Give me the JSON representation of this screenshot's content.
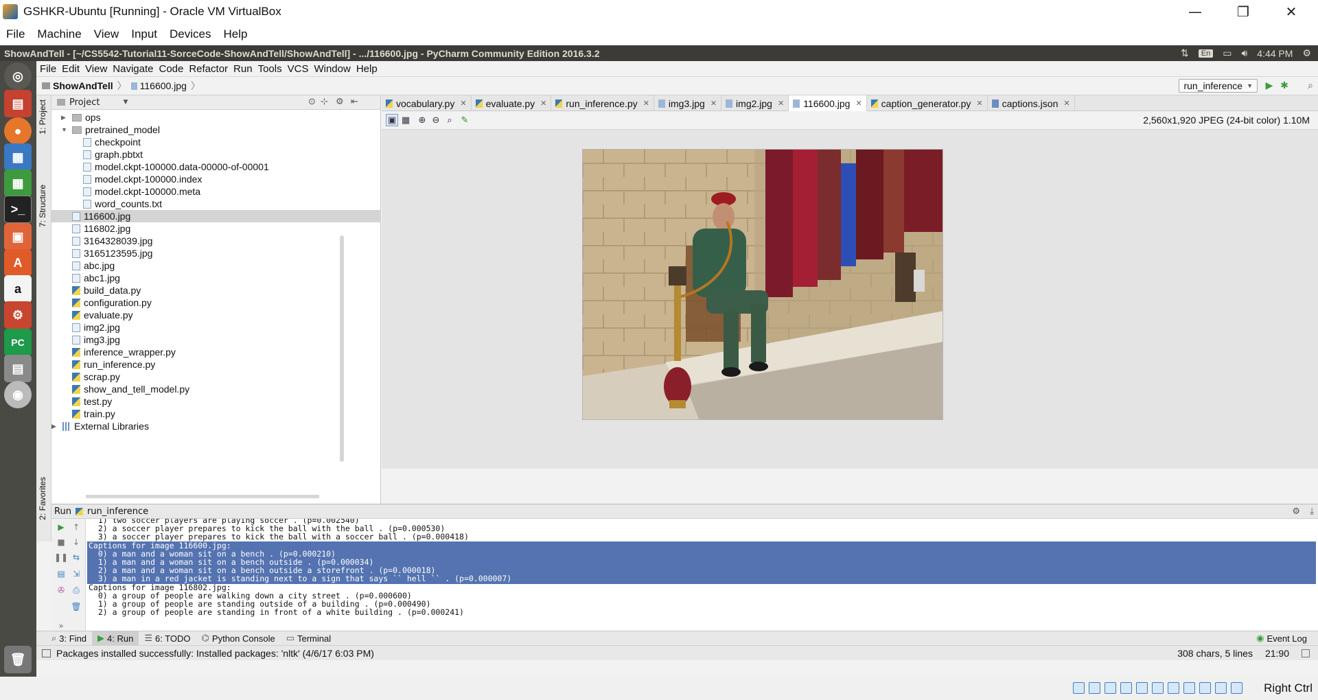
{
  "vbox": {
    "window_title": "GSHKR-Ubuntu [Running] - Oracle VM VirtualBox",
    "menu": [
      "File",
      "Machine",
      "View",
      "Input",
      "Devices",
      "Help"
    ],
    "host_key": "Right Ctrl"
  },
  "ubuntu": {
    "topbar_title": "ShowAndTell - [~/CS5542-Tutorial11-SorceCode-ShowAndTell/ShowAndTell] - .../116600.jpg - PyCharm Community Edition 2016.3.2",
    "keyboard": "En",
    "clock": "4:44 PM",
    "launcher_letters": {
      "pycharm": "PC",
      "software": "A",
      "amazon": "a"
    }
  },
  "pycharm": {
    "menu": [
      "File",
      "Edit",
      "View",
      "Navigate",
      "Code",
      "Refactor",
      "Run",
      "Tools",
      "VCS",
      "Window",
      "Help"
    ],
    "breadcrumb": [
      "ShowAndTell",
      "116600.jpg"
    ],
    "run_config": "run_inference",
    "side_tabs": {
      "project": "1: Project",
      "structure": "7: Structure",
      "favorites": "2: Favorites"
    },
    "project_panel": {
      "title": "Project",
      "tree": [
        {
          "label": "ops",
          "type": "folder",
          "arrow": "▶"
        },
        {
          "label": "pretrained_model",
          "type": "folder",
          "arrow": "▼"
        },
        {
          "label": "checkpoint",
          "type": "file"
        },
        {
          "label": "graph.pbtxt",
          "type": "file"
        },
        {
          "label": "model.ckpt-100000.data-00000-of-00001",
          "type": "file"
        },
        {
          "label": "model.ckpt-100000.index",
          "type": "file"
        },
        {
          "label": "model.ckpt-100000.meta",
          "type": "file"
        },
        {
          "label": "word_counts.txt",
          "type": "file"
        },
        {
          "label": "116600.jpg",
          "type": "img",
          "selected": true
        },
        {
          "label": "116802.jpg",
          "type": "img"
        },
        {
          "label": "3164328039.jpg",
          "type": "img"
        },
        {
          "label": "3165123595.jpg",
          "type": "img"
        },
        {
          "label": "abc.jpg",
          "type": "img"
        },
        {
          "label": "abc1.jpg",
          "type": "img"
        },
        {
          "label": "build_data.py",
          "type": "py"
        },
        {
          "label": "configuration.py",
          "type": "py"
        },
        {
          "label": "evaluate.py",
          "type": "py"
        },
        {
          "label": "img2.jpg",
          "type": "img"
        },
        {
          "label": "img3.jpg",
          "type": "img"
        },
        {
          "label": "inference_wrapper.py",
          "type": "py"
        },
        {
          "label": "run_inference.py",
          "type": "py"
        },
        {
          "label": "scrap.py",
          "type": "py"
        },
        {
          "label": "show_and_tell_model.py",
          "type": "py"
        },
        {
          "label": "test.py",
          "type": "py"
        },
        {
          "label": "train.py",
          "type": "py"
        },
        {
          "label": "External Libraries",
          "type": "lib",
          "arrow": "▶"
        }
      ]
    },
    "tabs": [
      {
        "label": "vocabulary.py",
        "type": "py"
      },
      {
        "label": "evaluate.py",
        "type": "py"
      },
      {
        "label": "run_inference.py",
        "type": "py"
      },
      {
        "label": "img3.jpg",
        "type": "img"
      },
      {
        "label": "img2.jpg",
        "type": "img"
      },
      {
        "label": "116600.jpg",
        "type": "img",
        "active": true
      },
      {
        "label": "caption_generator.py",
        "type": "py"
      },
      {
        "label": "captions.json",
        "type": "json"
      }
    ],
    "image_info": "2,560x1,920 JPEG (24-bit color) 1.10M",
    "run_panel": {
      "label": "Run",
      "config": "run_inference",
      "lines": [
        {
          "text": "  1) two soccer players are playing soccer . (p=0.002540)",
          "sel": false
        },
        {
          "text": "  2) a soccer player prepares to kick the ball with the ball . (p=0.000530)",
          "sel": false
        },
        {
          "text": "  3) a soccer player prepares to kick the ball with a soccer ball . (p=0.000418)",
          "sel": false
        },
        {
          "text": "Captions for image 116600.jpg:",
          "sel": true
        },
        {
          "text": "  0) a man and a woman sit on a bench . (p=0.000210)",
          "sel": true
        },
        {
          "text": "  1) a man and a woman sit on a bench outside . (p=0.000034)",
          "sel": true
        },
        {
          "text": "  2) a man and a woman sit on a bench outside a storefront . (p=0.000018)",
          "sel": true
        },
        {
          "text": "  3) a man in a red jacket is standing next to a sign that says `` hell `` . (p=0.000007)",
          "sel": true
        },
        {
          "text": "Captions for image 116802.jpg:",
          "sel": false
        },
        {
          "text": "  0) a group of people are walking down a city street . (p=0.000600)",
          "sel": false
        },
        {
          "text": "  1) a group of people are standing outside of a building . (p=0.000490)",
          "sel": false
        },
        {
          "text": "  2) a group of people are standing in front of a white building . (p=0.000241)",
          "sel": false
        }
      ]
    },
    "bottom_tools": [
      {
        "key": "find",
        "label": "3: Find"
      },
      {
        "key": "run",
        "label": "4: Run",
        "active": true
      },
      {
        "key": "todo",
        "label": "6: TODO"
      },
      {
        "key": "python-console",
        "label": "Python Console"
      },
      {
        "key": "terminal",
        "label": "Terminal"
      }
    ],
    "event_log": "Event Log",
    "status": {
      "message": "Packages installed successfully: Installed packages: 'nltk' (4/6/17 6:03 PM)",
      "selection": "308 chars, 5 lines",
      "position": "21:90"
    }
  }
}
